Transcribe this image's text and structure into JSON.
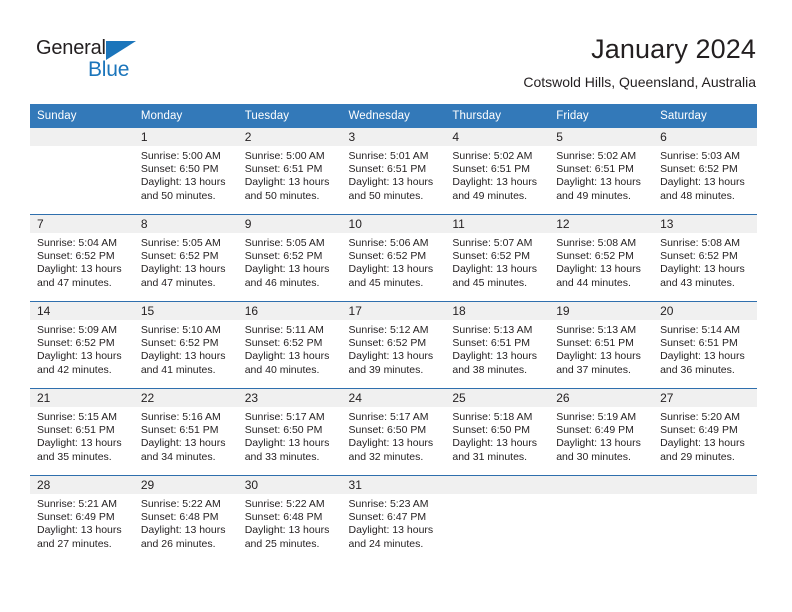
{
  "brand": {
    "name_top": "General",
    "name_bottom": "Blue",
    "accent_color": "#1b75bb",
    "triangle_icon": "triangle-icon"
  },
  "header": {
    "title": "January 2024",
    "subtitle": "Cotswold Hills, Queensland, Australia"
  },
  "theme": {
    "header_row_bg": "#3379b9",
    "header_row_text": "#ffffff",
    "daynum_bg": "#f0f0f0",
    "week_separator": "#2f6fad",
    "body_text": "#231f20"
  },
  "calendar": {
    "columns": [
      "Sunday",
      "Monday",
      "Tuesday",
      "Wednesday",
      "Thursday",
      "Friday",
      "Saturday"
    ],
    "weeks": [
      [
        {
          "day": "",
          "info": ""
        },
        {
          "day": "1",
          "info": "Sunrise: 5:00 AM\nSunset: 6:50 PM\nDaylight: 13 hours and 50 minutes."
        },
        {
          "day": "2",
          "info": "Sunrise: 5:00 AM\nSunset: 6:51 PM\nDaylight: 13 hours and 50 minutes."
        },
        {
          "day": "3",
          "info": "Sunrise: 5:01 AM\nSunset: 6:51 PM\nDaylight: 13 hours and 50 minutes."
        },
        {
          "day": "4",
          "info": "Sunrise: 5:02 AM\nSunset: 6:51 PM\nDaylight: 13 hours and 49 minutes."
        },
        {
          "day": "5",
          "info": "Sunrise: 5:02 AM\nSunset: 6:51 PM\nDaylight: 13 hours and 49 minutes."
        },
        {
          "day": "6",
          "info": "Sunrise: 5:03 AM\nSunset: 6:52 PM\nDaylight: 13 hours and 48 minutes."
        }
      ],
      [
        {
          "day": "7",
          "info": "Sunrise: 5:04 AM\nSunset: 6:52 PM\nDaylight: 13 hours and 47 minutes."
        },
        {
          "day": "8",
          "info": "Sunrise: 5:05 AM\nSunset: 6:52 PM\nDaylight: 13 hours and 47 minutes."
        },
        {
          "day": "9",
          "info": "Sunrise: 5:05 AM\nSunset: 6:52 PM\nDaylight: 13 hours and 46 minutes."
        },
        {
          "day": "10",
          "info": "Sunrise: 5:06 AM\nSunset: 6:52 PM\nDaylight: 13 hours and 45 minutes."
        },
        {
          "day": "11",
          "info": "Sunrise: 5:07 AM\nSunset: 6:52 PM\nDaylight: 13 hours and 45 minutes."
        },
        {
          "day": "12",
          "info": "Sunrise: 5:08 AM\nSunset: 6:52 PM\nDaylight: 13 hours and 44 minutes."
        },
        {
          "day": "13",
          "info": "Sunrise: 5:08 AM\nSunset: 6:52 PM\nDaylight: 13 hours and 43 minutes."
        }
      ],
      [
        {
          "day": "14",
          "info": "Sunrise: 5:09 AM\nSunset: 6:52 PM\nDaylight: 13 hours and 42 minutes."
        },
        {
          "day": "15",
          "info": "Sunrise: 5:10 AM\nSunset: 6:52 PM\nDaylight: 13 hours and 41 minutes."
        },
        {
          "day": "16",
          "info": "Sunrise: 5:11 AM\nSunset: 6:52 PM\nDaylight: 13 hours and 40 minutes."
        },
        {
          "day": "17",
          "info": "Sunrise: 5:12 AM\nSunset: 6:52 PM\nDaylight: 13 hours and 39 minutes."
        },
        {
          "day": "18",
          "info": "Sunrise: 5:13 AM\nSunset: 6:51 PM\nDaylight: 13 hours and 38 minutes."
        },
        {
          "day": "19",
          "info": "Sunrise: 5:13 AM\nSunset: 6:51 PM\nDaylight: 13 hours and 37 minutes."
        },
        {
          "day": "20",
          "info": "Sunrise: 5:14 AM\nSunset: 6:51 PM\nDaylight: 13 hours and 36 minutes."
        }
      ],
      [
        {
          "day": "21",
          "info": "Sunrise: 5:15 AM\nSunset: 6:51 PM\nDaylight: 13 hours and 35 minutes."
        },
        {
          "day": "22",
          "info": "Sunrise: 5:16 AM\nSunset: 6:51 PM\nDaylight: 13 hours and 34 minutes."
        },
        {
          "day": "23",
          "info": "Sunrise: 5:17 AM\nSunset: 6:50 PM\nDaylight: 13 hours and 33 minutes."
        },
        {
          "day": "24",
          "info": "Sunrise: 5:17 AM\nSunset: 6:50 PM\nDaylight: 13 hours and 32 minutes."
        },
        {
          "day": "25",
          "info": "Sunrise: 5:18 AM\nSunset: 6:50 PM\nDaylight: 13 hours and 31 minutes."
        },
        {
          "day": "26",
          "info": "Sunrise: 5:19 AM\nSunset: 6:49 PM\nDaylight: 13 hours and 30 minutes."
        },
        {
          "day": "27",
          "info": "Sunrise: 5:20 AM\nSunset: 6:49 PM\nDaylight: 13 hours and 29 minutes."
        }
      ],
      [
        {
          "day": "28",
          "info": "Sunrise: 5:21 AM\nSunset: 6:49 PM\nDaylight: 13 hours and 27 minutes."
        },
        {
          "day": "29",
          "info": "Sunrise: 5:22 AM\nSunset: 6:48 PM\nDaylight: 13 hours and 26 minutes."
        },
        {
          "day": "30",
          "info": "Sunrise: 5:22 AM\nSunset: 6:48 PM\nDaylight: 13 hours and 25 minutes."
        },
        {
          "day": "31",
          "info": "Sunrise: 5:23 AM\nSunset: 6:47 PM\nDaylight: 13 hours and 24 minutes."
        },
        {
          "day": "",
          "info": ""
        },
        {
          "day": "",
          "info": ""
        },
        {
          "day": "",
          "info": ""
        }
      ]
    ]
  }
}
